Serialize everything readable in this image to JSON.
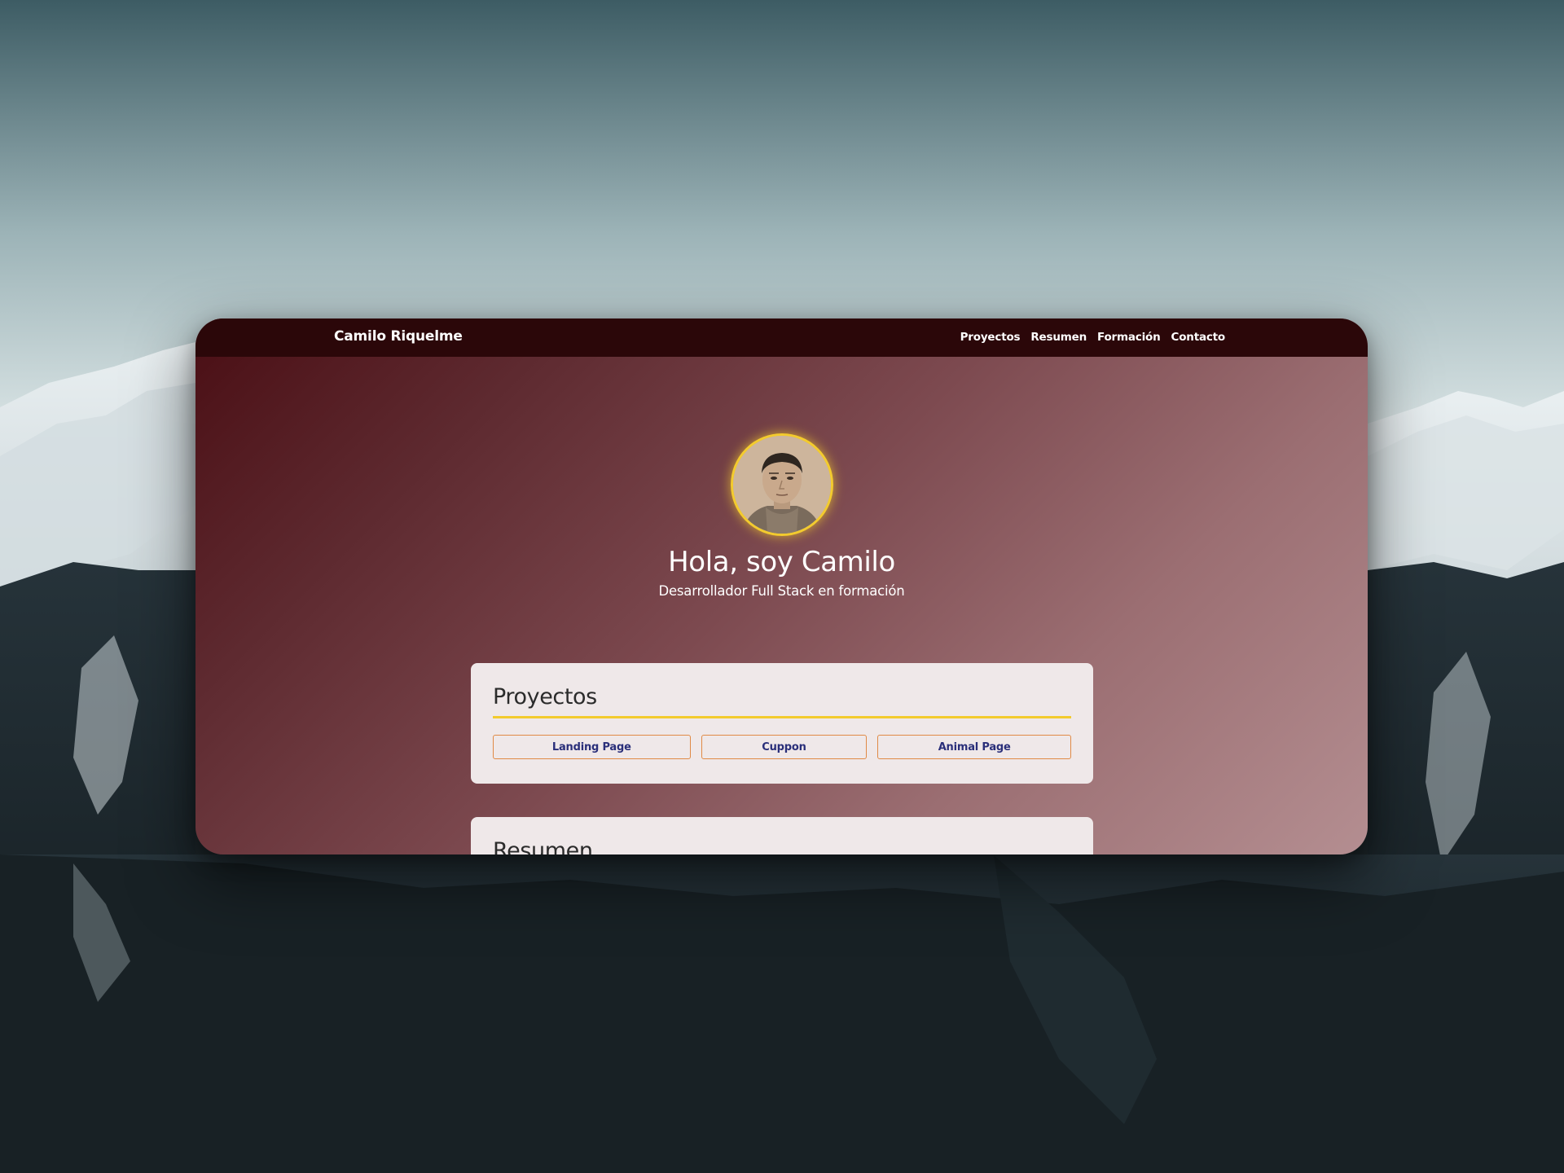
{
  "navbar": {
    "brand": "Camilo Riquelme",
    "links": [
      {
        "label": "Proyectos"
      },
      {
        "label": "Resumen"
      },
      {
        "label": "Formación"
      },
      {
        "label": "Contacto"
      }
    ]
  },
  "hero": {
    "title": "Hola, soy Camilo",
    "subtitle": "Desarrollador Full Stack en formación"
  },
  "projects": {
    "title": "Proyectos",
    "buttons": [
      {
        "label": "Landing Page"
      },
      {
        "label": "Cuppon"
      },
      {
        "label": "Animal Page"
      }
    ]
  },
  "resumen": {
    "title": "Resumen"
  },
  "colors": {
    "navbar_bg": "#2b0709",
    "accent_yellow": "#f3cb2e",
    "button_border": "#e08a46",
    "button_text": "#2a2f7a",
    "card_bg": "#efe8e9"
  }
}
